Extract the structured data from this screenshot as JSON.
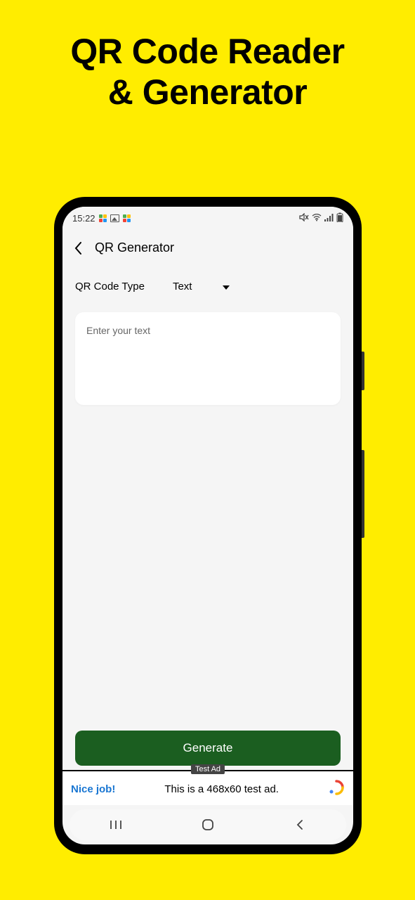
{
  "promo": {
    "line1": "QR Code Reader",
    "line2": "& Generator"
  },
  "status_bar": {
    "time": "15:22"
  },
  "header": {
    "title": "QR Generator"
  },
  "qr_type": {
    "label": "QR Code Type",
    "selected": "Text"
  },
  "input": {
    "placeholder": "Enter your text"
  },
  "generate_button": {
    "label": "Generate"
  },
  "ad": {
    "badge": "Test Ad",
    "left_text": "Nice job!",
    "body": "This is a 468x60 test ad."
  }
}
